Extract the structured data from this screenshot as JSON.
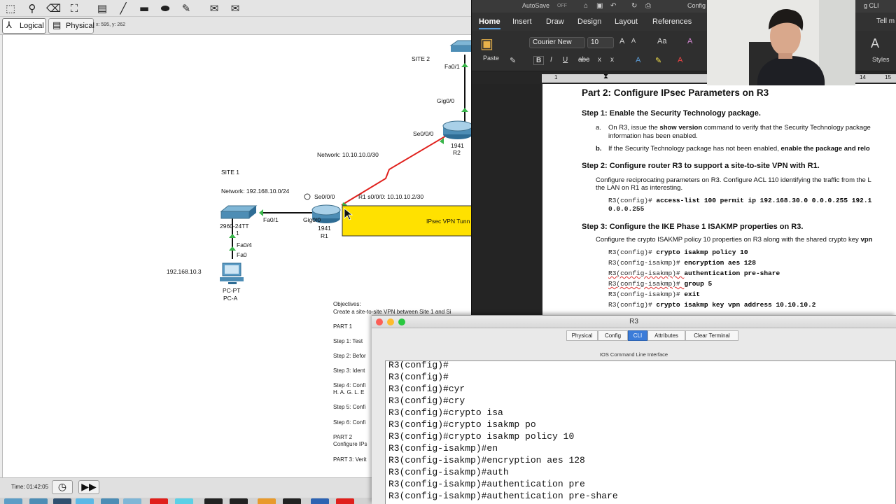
{
  "packet_tracer": {
    "modes": {
      "logical": "Logical",
      "physical": "Physical"
    },
    "coords": "x: 595, y: 262",
    "time": "Time: 01:42:05",
    "canvas_labels": {
      "site1": "SITE 1",
      "site2": "SITE 2",
      "network_lan1": "Network: 192.168.10.0/24",
      "network_wan": "Network: 10.10.10.0/30",
      "r1_serial": "R1 s0/0/0: 10.10.10.2/30",
      "se000_r1": "Se0/0/0",
      "se000_r2": "Se0/0/0",
      "gig000_r1": "Gig0/0",
      "gig000_r2": "Gig0/0",
      "fa01_sw": "Fa0/1",
      "fa01_top": "Fa0/1",
      "fa04": "Fa0/4",
      "fa0": "Fa0",
      "sw_model": "2960-24TT",
      "sw_suffix": "1",
      "r1_model": "1941",
      "r1_name": "R1",
      "r2_model": "1941",
      "r2_name": "R2",
      "pc_ip": "192.168.10.3",
      "pc_type": "PC-PT",
      "pc_name": "PC-A",
      "tunnel": "IPsec VPN Tunn"
    },
    "objectives": [
      "Objectives:",
      "Create a site-to-site VPN between Site 1 and Si",
      "PART 1",
      "Step 1: Test",
      "Step 2: Befor",
      "Step 3: Ident",
      "Step 4: Confi",
      "H. A. G. L. E",
      "Step 5: Confi",
      "Step 6: Confi",
      "PART 2",
      "Configure IPs",
      "PART 3: Verit"
    ]
  },
  "word": {
    "autosave": "AutoSave",
    "autosave_state": "OFF",
    "title": "Config",
    "title_right": "g CLI",
    "tabs": [
      "Home",
      "Insert",
      "Draw",
      "Design",
      "Layout",
      "References"
    ],
    "tell_me": "Tell m",
    "paste": "Paste",
    "font": "Courier New",
    "font_size": "10",
    "styles": "Styles",
    "ruler_nums": [
      "1",
      "14",
      "15"
    ],
    "doc": {
      "part_heading": "Part 2: Configure IPsec Parameters on R3",
      "step1": "Step 1: Enable the Security Technology package.",
      "step1a_label": "a.",
      "step1a_pre": "On R3, issue the ",
      "step1a_cmd": "show version",
      "step1a_post": " command to verify that the Security Technology package",
      "step1a_line2": "information has been enabled.",
      "step1b_label": "b.",
      "step1b_pre": "If the Security Technology package has not been enabled, ",
      "step1b_bold": "enable the package and relo",
      "step2": "Step 2: Configure router R3 to support a site-to-site VPN with R1.",
      "step2_p1": "Configure reciprocating parameters on R3. Configure ACL 110 identifying the traffic from the L",
      "step2_p2": "the LAN on R1 as interesting.",
      "acl_prompt": "R3(config)# ",
      "acl_cmd": "access-list 100 permit ip 192.168.30.0 0.0.0.255 192.1",
      "acl_cmd2": "0.0.0.255",
      "step3": "Step 3: Configure the IKE Phase 1 ISAKMP properties on R3.",
      "step3_p": "Configure the crypto ISAKMP policy 10 properties on R3 along with the shared crypto key ",
      "step3_p_bold": "vpn",
      "code": [
        {
          "prompt": "R3(config)# ",
          "cmd": "crypto isakmp policy 10"
        },
        {
          "prompt": "R3(config-isakmp)# ",
          "cmd": "encryption aes 128"
        },
        {
          "prompt": "R3(config-isakmp)# ",
          "cmd": "authentication pre-share"
        },
        {
          "prompt": "R3(config-isakmp)# ",
          "cmd": "group 5"
        },
        {
          "prompt": "R3(config-isakmp)# ",
          "cmd": "exit"
        },
        {
          "prompt": "R3(config)# ",
          "cmd": "crypto isakmp key vpn address 10.10.10.2"
        }
      ]
    }
  },
  "r3": {
    "title": "R3",
    "tabs": [
      "Physical",
      "Config",
      "CLI",
      "Attributes",
      "Clear Terminal"
    ],
    "active_tab": "CLI",
    "ios_label": "IOS Command Line Interface",
    "lines": [
      "R3(config)#",
      "R3(config)#",
      "R3(config)#cyr",
      "R3(config)#cry",
      "R3(config)#crypto isa",
      "R3(config)#crypto isakmp po",
      "R3(config)#crypto isakmp policy 10",
      "R3(config-isakmp)#en",
      "R3(config-isakmp)#encryption aes 128",
      "R3(config-isakmp)#auth",
      "R3(config-isakmp)#authentication pre",
      "R3(config-isakmp)#authentication pre-share"
    ]
  },
  "colors": {
    "serial_link": "#e0201c",
    "link_up": "#39b54a",
    "tunnel_fill": "#ffe100",
    "cli_active_tab": "#3b7cd9",
    "word_accent": "#5b9bd5"
  }
}
